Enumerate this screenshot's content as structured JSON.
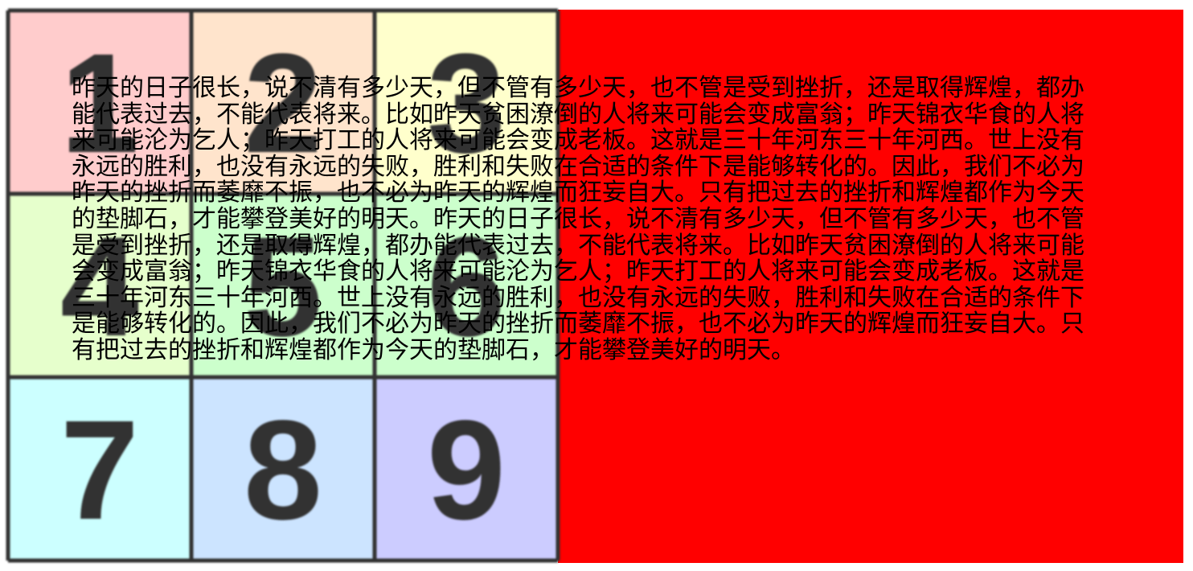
{
  "colors": {
    "red_block": "#ff0000",
    "cells": [
      "#ffcccc",
      "#ffe4cc",
      "#ffffcc",
      "#e6ffcc",
      "#ccffcc",
      "#ccffcc",
      "#ccffff",
      "#cce4ff",
      "#ccccff"
    ],
    "grid_lines": "#333333",
    "text": "#000000"
  },
  "grid": {
    "numbers": [
      "1",
      "2",
      "3",
      "4",
      "5",
      "6",
      "7",
      "8",
      "9"
    ]
  },
  "paragraph": "昨天的日子很长，说不清有多少天，但不管有多少天，也不管是受到挫折，还是取得辉煌，都办能代表过去，不能代表将来。比如昨天贫困潦倒的人将来可能会变成富翁；昨天锦衣华食的人将来可能沦为乞人；昨天打工的人将来可能会变成老板。这就是三十年河东三十年河西。世上没有永远的胜利，也没有永远的失败，胜利和失败在合适的条件下是能够转化的。因此，我们不必为昨天的挫折而萎靡不振，也不必为昨天的辉煌而狂妄自大。只有把过去的挫折和辉煌都作为今天的垫脚石，才能攀登美好的明天。昨天的日子很长，说不清有多少天，但不管有多少天，也不管是受到挫折，还是取得辉煌，都办能代表过去，不能代表将来。比如昨天贫困潦倒的人将来可能会变成富翁；昨天锦衣华食的人将来可能沦为乞人；昨天打工的人将来可能会变成老板。这就是三十年河东三十年河西。世上没有永远的胜利，也没有永远的失败，胜利和失败在合适的条件下是能够转化的。因此，我们不必为昨天的挫折而萎靡不振，也不必为昨天的辉煌而狂妄自大。只有把过去的挫折和辉煌都作为今天的垫脚石，才能攀登美好的明天。"
}
